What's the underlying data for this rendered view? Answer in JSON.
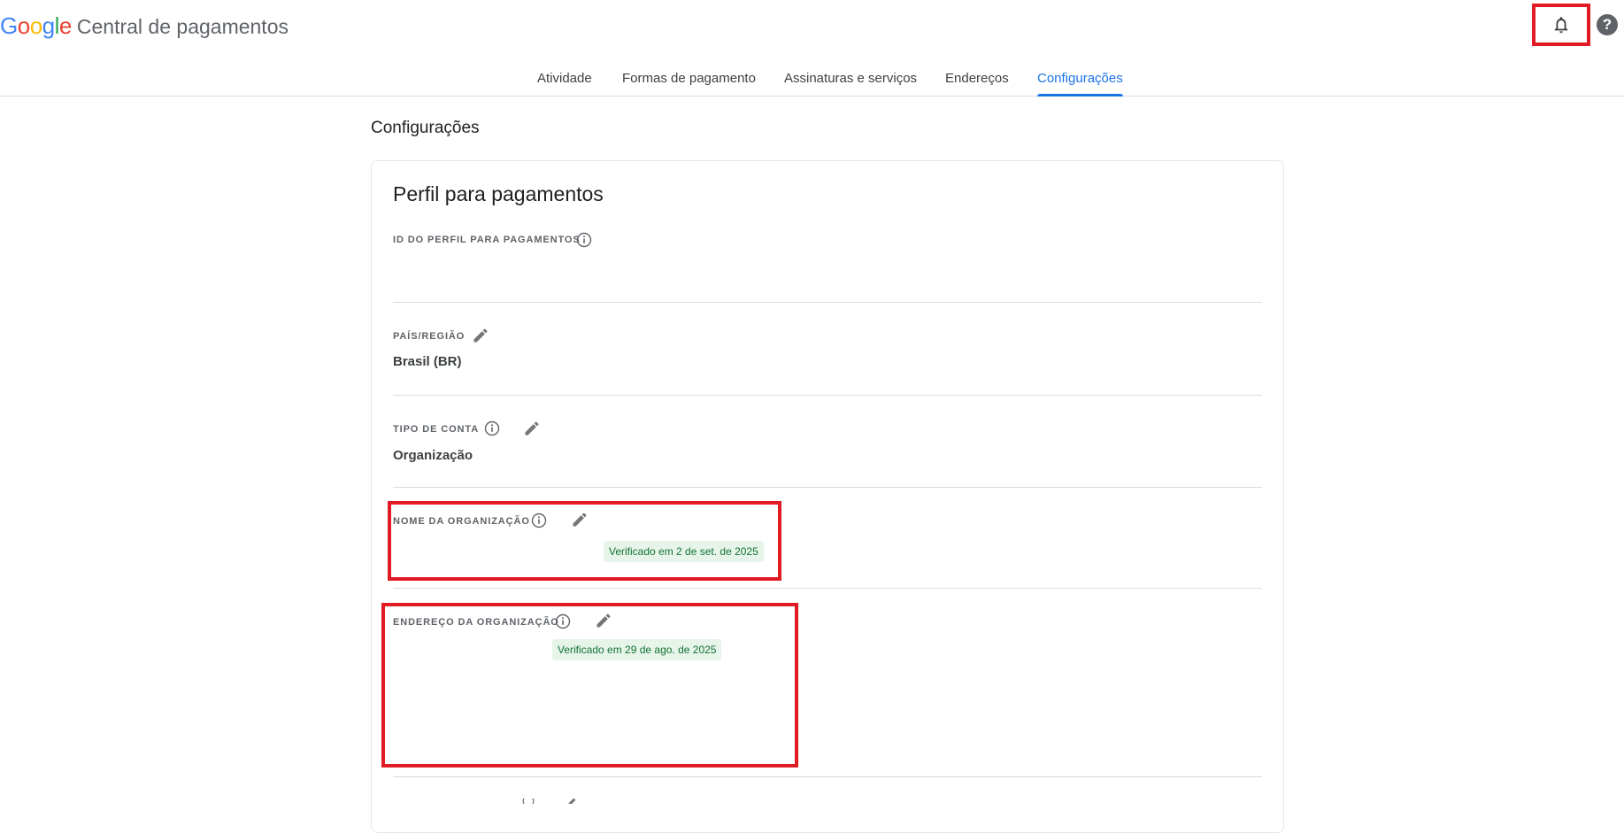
{
  "header": {
    "logo": {
      "letters": [
        "G",
        "o",
        "o",
        "g",
        "l",
        "e"
      ],
      "colors": [
        "#4285F4",
        "#EA4335",
        "#FBBC05",
        "#4285F4",
        "#34A853",
        "#EA4335"
      ]
    },
    "product_name": "Central de pagamentos",
    "help_glyph": "?"
  },
  "nav": {
    "tabs": [
      {
        "label": "Atividade"
      },
      {
        "label": "Formas de pagamento"
      },
      {
        "label": "Assinaturas e serviços"
      },
      {
        "label": "Endereços"
      },
      {
        "label": "Configurações",
        "active": true
      }
    ],
    "accent": "#1a73e8"
  },
  "page": {
    "title": "Configurações"
  },
  "card": {
    "title": "Perfil para pagamentos",
    "fields": {
      "profile_id": {
        "label": "ID DO PERFIL PARA PAGAMENTOS"
      },
      "country": {
        "label": "PAÍS/REGIÃO",
        "value": "Brasil (BR)"
      },
      "account_type": {
        "label": "TIPO DE CONTA",
        "value": "Organização"
      },
      "org_name": {
        "label": "NOME DA ORGANIZAÇÃO",
        "badge": "Verificado em 2 de set. de 2025"
      },
      "org_address": {
        "label": "ENDEREÇO DA ORGANIZAÇÃO",
        "badge": "Verificado em 29 de ago. de 2025"
      }
    }
  },
  "icons": {
    "notification": "bell-icon",
    "help": "help-icon",
    "info": "info-icon",
    "edit": "pencil-icon"
  },
  "colors": {
    "highlight": "#e01b24",
    "verified_bg": "#e6f4ea",
    "verified_text": "#137333"
  }
}
